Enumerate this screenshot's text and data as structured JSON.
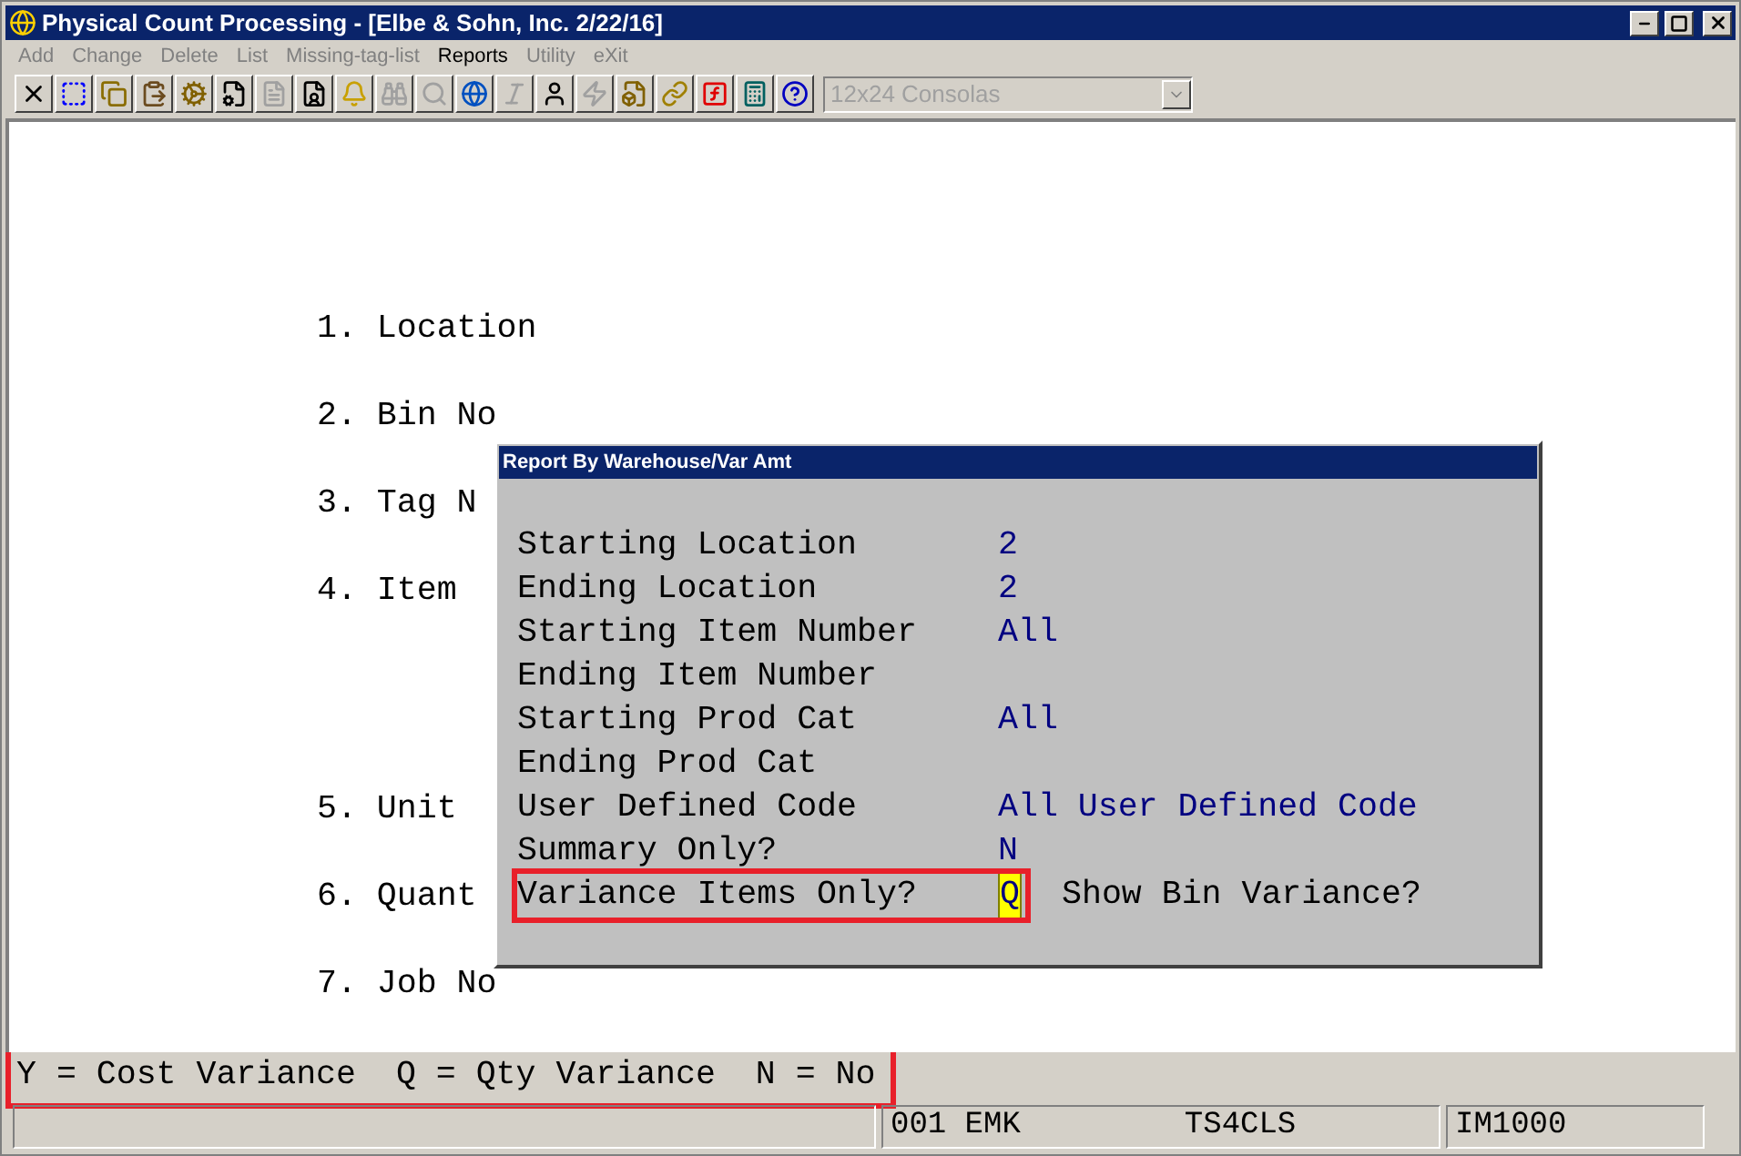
{
  "window": {
    "title": "Physical Count Processing - [Elbe & Sohn, Inc. 2/22/16]"
  },
  "menu": [
    {
      "label": "Add",
      "disabled": true
    },
    {
      "label": "Change",
      "disabled": true
    },
    {
      "label": "Delete",
      "disabled": true
    },
    {
      "label": "List",
      "disabled": true
    },
    {
      "label": "Missing-tag-list",
      "disabled": true
    },
    {
      "label": "Reports",
      "disabled": false
    },
    {
      "label": "Utility",
      "disabled": true
    },
    {
      "label": "eXit",
      "disabled": true
    }
  ],
  "toolbar": [
    {
      "disabled": false
    },
    {
      "disabled": false
    },
    {
      "disabled": false
    },
    {
      "disabled": false
    },
    {
      "disabled": false
    },
    {
      "disabled": false
    },
    {
      "disabled": true
    },
    {
      "disabled": false
    },
    {
      "disabled": false
    },
    {
      "disabled": true
    },
    {
      "disabled": true
    },
    {
      "disabled": false
    },
    {
      "disabled": true
    },
    {
      "disabled": false
    },
    {
      "disabled": true
    },
    {
      "disabled": false
    },
    {
      "disabled": false
    },
    {
      "disabled": false
    },
    {
      "disabled": false
    },
    {
      "disabled": false
    }
  ],
  "font_select": {
    "value": "12x24 Consolas",
    "disabled": true
  },
  "screen_menu": [
    "1. Location",
    "2. Bin No",
    "3. Tag N",
    "4. Item",
    "5. Unit",
    "6. Quant",
    "7. Job No"
  ],
  "dialog": {
    "title": "Report By Warehouse/Var Amt",
    "fields": [
      {
        "label": "Starting Location",
        "value": "2",
        "active": false
      },
      {
        "label": "Ending Location",
        "value": "2",
        "active": false
      },
      {
        "label": "Starting Item Number",
        "value": "All",
        "active": false
      },
      {
        "label": "Ending Item Number"
      },
      {
        "label": "Starting Prod Cat",
        "value": "All",
        "active": false
      },
      {
        "label": "Ending Prod Cat"
      },
      {
        "label": "User Defined Code",
        "value": "All User Defined Code",
        "active": false
      },
      {
        "label": "Summary Only?",
        "value": "N",
        "active": false
      },
      {
        "label": "Variance Items Only?",
        "value": "Q",
        "active": true,
        "highlighted": true,
        "next_label": "Show Bin Variance?"
      }
    ]
  },
  "hint": {
    "text": "Y = Cost Variance  Q = Qty Variance  N = No",
    "highlighted": true
  },
  "status_bar": {
    "panels": [
      {
        "texts": [
          "001 EMK",
          "TS4CLS"
        ]
      },
      {
        "texts": [
          "IM1000"
        ]
      }
    ]
  }
}
